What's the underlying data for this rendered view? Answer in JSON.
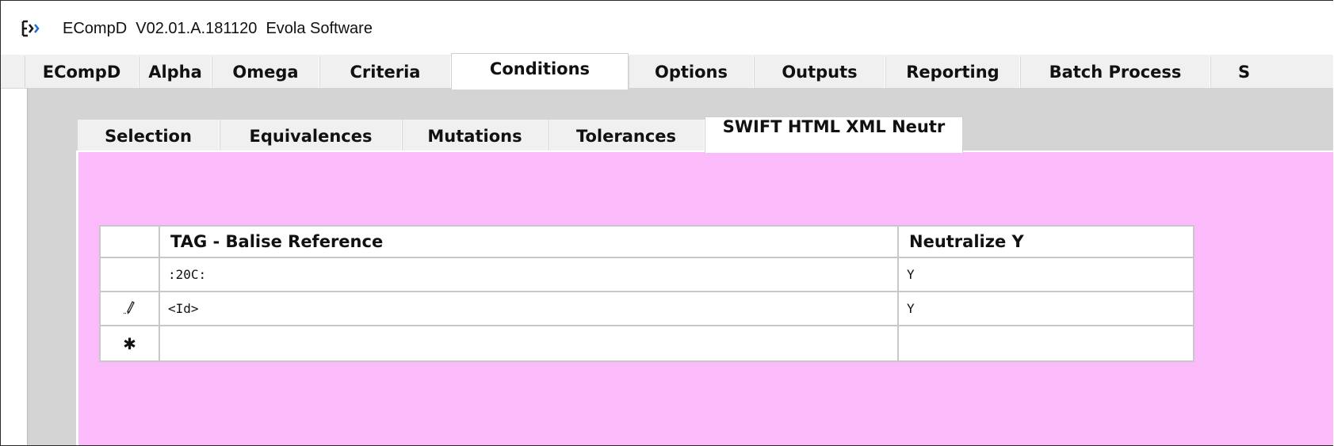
{
  "window": {
    "title": "ECompD  V02.01.A.181120  Evola Software",
    "icon": "app-logo-icon"
  },
  "tabs": [
    {
      "label": "ECompD"
    },
    {
      "label": "Alpha"
    },
    {
      "label": "Omega"
    },
    {
      "label": "Criteria"
    },
    {
      "label": "Conditions",
      "active": true
    },
    {
      "label": "Options"
    },
    {
      "label": "Outputs"
    },
    {
      "label": "Reporting"
    },
    {
      "label": "Batch Process"
    },
    {
      "label": "S"
    }
  ],
  "subtabs": [
    {
      "label": "Selection"
    },
    {
      "label": "Equivalences"
    },
    {
      "label": "Mutations"
    },
    {
      "label": "Tolerances"
    },
    {
      "label": "SWIFT HTML XML Neutr",
      "active": true
    }
  ],
  "grid": {
    "columns": [
      "TAG - Balise Reference",
      "Neutralize Y"
    ],
    "rows": [
      {
        "indicator": "",
        "tag": ":20C:",
        "neutralize": "Y"
      },
      {
        "indicator": "pencil-icon",
        "tag": "<Id>",
        "neutralize": "Y"
      },
      {
        "indicator": "asterisk-icon",
        "tag": "",
        "neutralize": ""
      }
    ],
    "new_row_glyph": "✱"
  },
  "colors": {
    "content_bg": "#fbbbfb",
    "panel_bg": "#d4d4d4",
    "tab_bg": "#f0f0f0",
    "active_tab_bg": "#ffffff"
  }
}
